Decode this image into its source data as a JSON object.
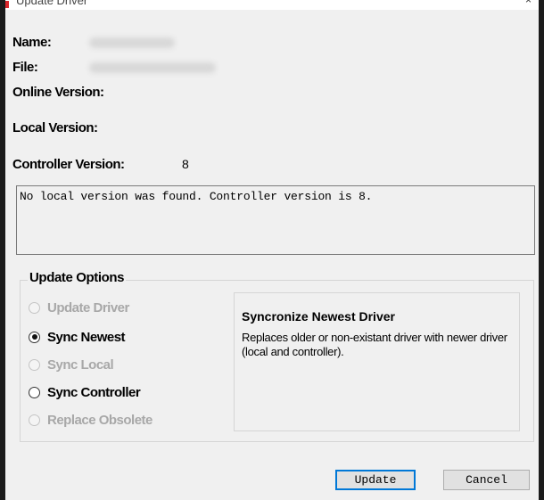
{
  "window": {
    "title": "Update Driver",
    "close_glyph": "×"
  },
  "fields": {
    "name_label": "Name:",
    "file_label": "File:",
    "online_version_label": "Online Version:",
    "local_version_label": "Local Version:",
    "controller_version_label": "Controller Version:",
    "controller_version_value": "8"
  },
  "message": "No local version was found. Controller version is 8.",
  "update_options": {
    "title": "Update Options",
    "options": [
      {
        "label": "Update Driver",
        "enabled": false,
        "checked": false
      },
      {
        "label": "Sync Newest",
        "enabled": true,
        "checked": true
      },
      {
        "label": "Sync Local",
        "enabled": false,
        "checked": false
      },
      {
        "label": "Sync Controller",
        "enabled": true,
        "checked": false
      },
      {
        "label": "Replace Obsolete",
        "enabled": false,
        "checked": false
      }
    ],
    "description": {
      "title": "Syncronize Newest Driver",
      "text": "Replaces older or non-existant driver with newer driver (local and controller)."
    }
  },
  "buttons": {
    "update": "Update",
    "cancel": "Cancel"
  },
  "icons": {
    "app": "app-icon",
    "close": "close-icon",
    "radio_checked": "radio-checked",
    "radio_unchecked": "radio-unchecked"
  },
  "colors": {
    "default_button_border": "#0078d7",
    "disabled_text": "#a8a8a8"
  }
}
